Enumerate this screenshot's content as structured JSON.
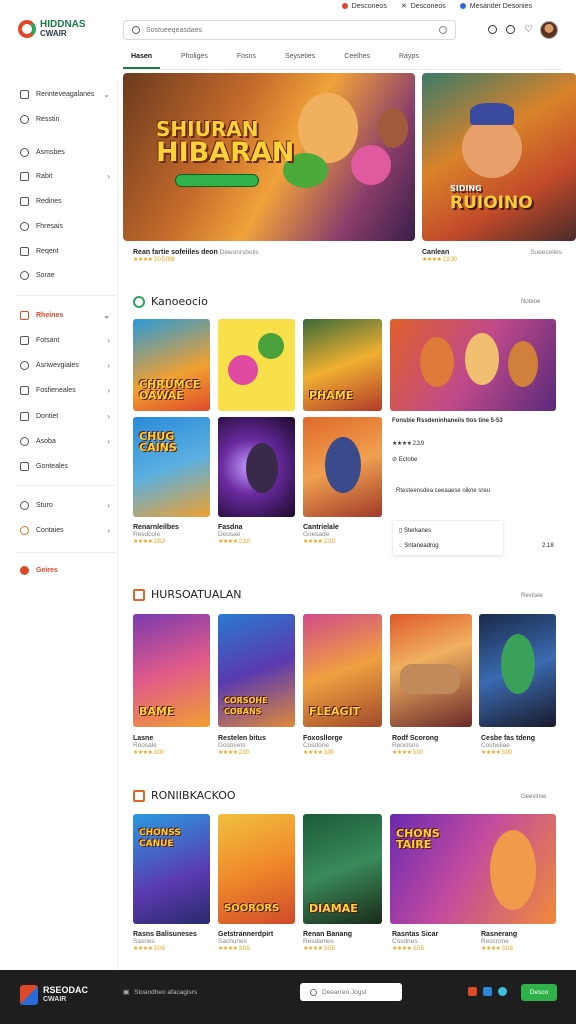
{
  "topbar": {
    "items": [
      "Desconeos",
      "Desconeos",
      "Mesander Desonies"
    ]
  },
  "brand": {
    "line1": "HIDDNAS",
    "line2": "CWAIR"
  },
  "search": {
    "placeholder": "Sostueeqeasdaes"
  },
  "tabs": [
    {
      "label": "Hasen"
    },
    {
      "label": "Pholiges"
    },
    {
      "label": "Fosns"
    },
    {
      "label": "Seyseties"
    },
    {
      "label": "Ceelhes"
    },
    {
      "label": "Rayps"
    }
  ],
  "sidebar": {
    "items": [
      {
        "label": "Rennteveagalanes"
      },
      {
        "label": "Resstin"
      },
      {
        "label": "Asmsbes"
      },
      {
        "label": "Rabit"
      },
      {
        "label": "Redines"
      },
      {
        "label": "Fhresais"
      },
      {
        "label": "Reqent"
      },
      {
        "label": "Sorae"
      },
      {
        "label": "Rheines"
      },
      {
        "label": "Fotsant"
      },
      {
        "label": "Asriwevgiales"
      },
      {
        "label": "Fosfieneales"
      },
      {
        "label": "Dontiet"
      },
      {
        "label": "Asoba"
      },
      {
        "label": "Gonteales"
      },
      {
        "label": "Sturo"
      },
      {
        "label": "Contaies"
      },
      {
        "label": "Geires"
      }
    ]
  },
  "hero": {
    "main": {
      "title_line1": "SHIURAN",
      "title_line2": "HIBARAN",
      "caption": "Rean fartie sofeiiles deon",
      "caption_sub": "Dewonrsbolis",
      "meta": "★★★★ 3.0  5.008"
    },
    "side": {
      "title": "RUIOINO",
      "subtitle": "SIDING",
      "caption": "Canlean",
      "meta": "Sueeceiles",
      "rating": "★★★★ 2.9  30"
    }
  },
  "section1": {
    "title": "Kanoeocio",
    "more": "Noteoe",
    "cards": [
      {
        "title": "CHRUMCE\nOAWAE",
        "name": "",
        "meta": ""
      },
      {
        "title": "",
        "name": "",
        "meta": ""
      },
      {
        "title": "PHAME",
        "name": "",
        "meta": ""
      },
      {
        "title": "",
        "name": "",
        "meta": ""
      },
      {
        "title": "CHUG\nCAINS",
        "name": "Renarnleilbes",
        "meta": "Resdcole",
        "rating": "★★★★ 2.8.3"
      },
      {
        "title": "",
        "name": "Fasdna",
        "meta": "Deosae",
        "rating": "★★★★ 2.3.0"
      },
      {
        "title": "",
        "name": "Cantrielale",
        "meta": "Goesade",
        "rating": "★★★★ 2.3.0"
      }
    ],
    "panel": {
      "title": "Fonsbie Rssdeninhaneiis tlos tine 5-53",
      "rating": "★★★★ 2.3.9",
      "tag": "Ectobe",
      "desc": "Rtesteensdea ceeaaese oikne sreu",
      "dd1": "Sterkanes",
      "dd2": "Sntaneadrog",
      "num": "2.18"
    }
  },
  "section2": {
    "title": "HURSOATUALAN",
    "more": "Revisee",
    "cards": [
      {
        "title": "BAME",
        "name": "Lasne",
        "meta": "Reosale",
        "rating": "★★★★ 3.00"
      },
      {
        "title": "CORSOHE\nCOBANS",
        "name": "Restelen bitus",
        "meta": "Gosbvets",
        "rating": "★★★★ 2.00"
      },
      {
        "title": "FLEAGIT",
        "name": "Foxosllorge",
        "meta": "Cosdone",
        "rating": "★★★★ 3.00"
      },
      {
        "title": "",
        "name": "Rodf Scorong",
        "meta": "Reoclsns",
        "rating": "★★★★ 3.00"
      },
      {
        "title": "",
        "name": "Cesbe fas tdeng",
        "meta": "Cosheliae",
        "rating": "★★★★ 3.00"
      }
    ]
  },
  "section3": {
    "title": "RONIIBKACKOO",
    "more": "Geevinse",
    "cards": [
      {
        "title": "CHONSS\nCANUE",
        "name": "Rasns Balisuneses",
        "meta": "Sasnes",
        "rating": "★★★★ 3.0.5"
      },
      {
        "title": "SOORORS",
        "name": "Getstrannerdpirt",
        "meta": "Sachunes",
        "rating": "★★★★ 3.0.5"
      },
      {
        "title": "DIAMAE",
        "name": "Renan Banang",
        "meta": "Resdanles",
        "rating": "★★★★ 3.0.5"
      },
      {
        "title": "CHONS\nTAIRE",
        "name": "Rasntas Sicar",
        "meta": "Cosdnes",
        "rating": "★★★★ 3.0.5"
      },
      {
        "title": "",
        "name": "Rasnerang",
        "meta": "Rescrone",
        "rating": "★★★★ 3.0.5"
      }
    ]
  },
  "footer": {
    "brand_line1": "RSEODAC",
    "brand_line2": "CWAIR",
    "copyright": "Stoandheo afacagisrs",
    "search_placeholder": "Deearren Jogst",
    "button": "Desco"
  },
  "colors": {
    "accent": "#2fb24a",
    "brand_red": "#e0482a",
    "footer_bg": "#1e1e1e"
  }
}
